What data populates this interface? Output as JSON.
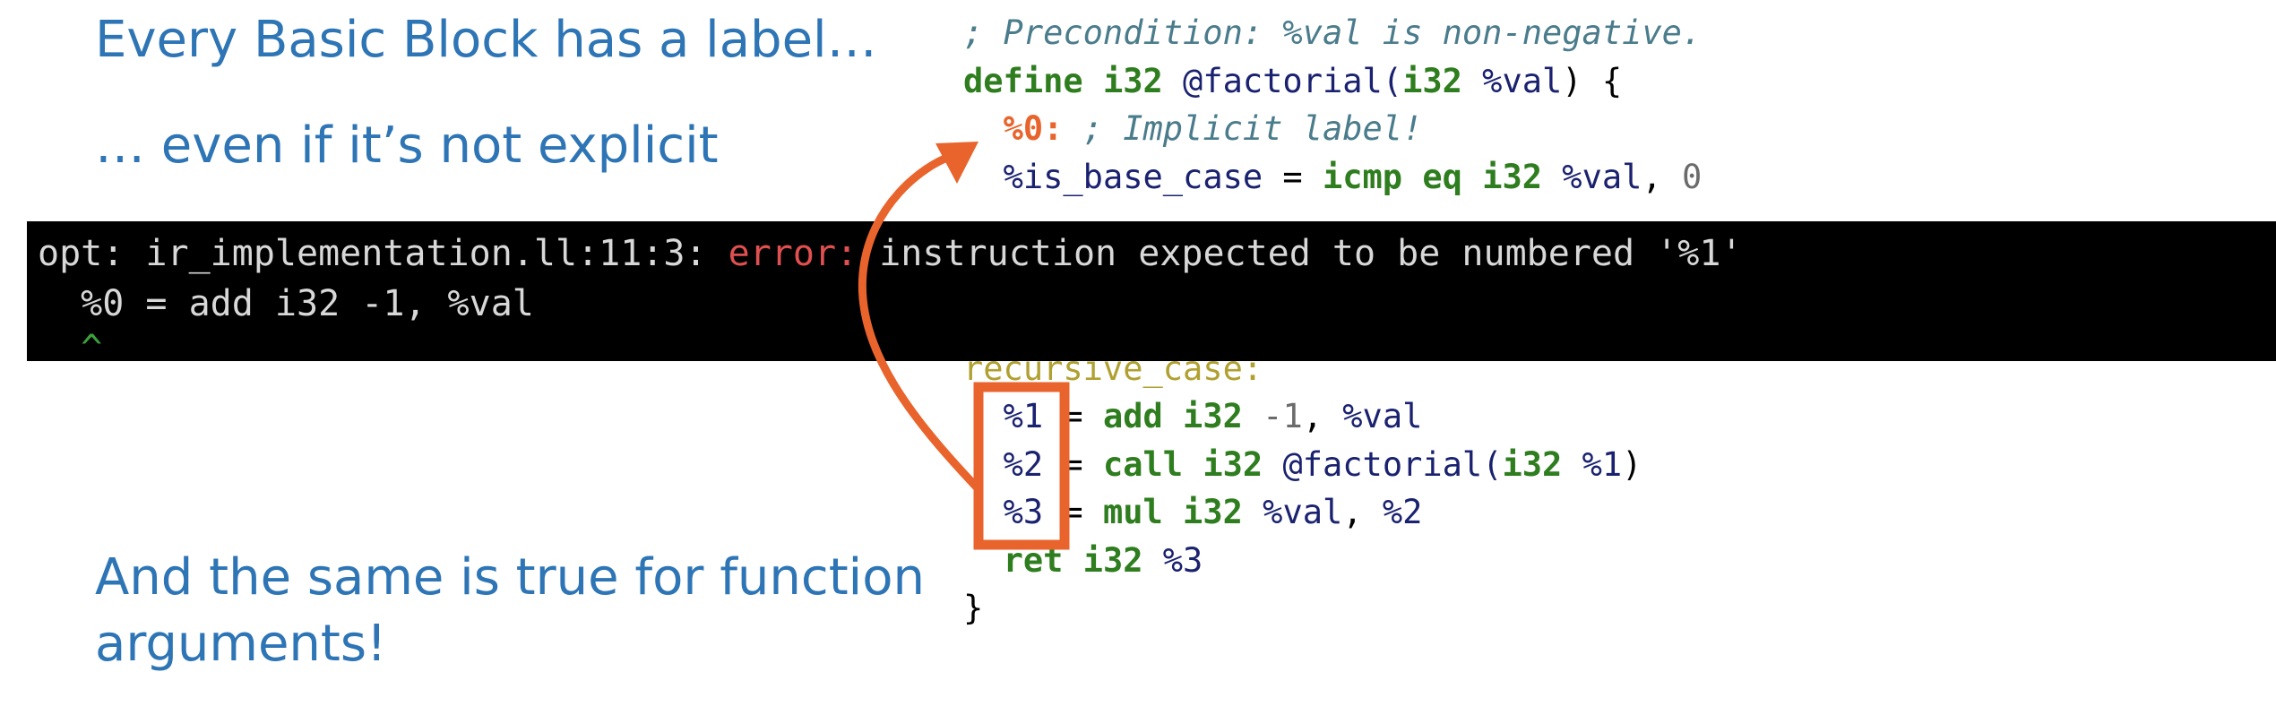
{
  "headings": {
    "line1": "Every Basic Block has a label…",
    "line2": "… even if it’s not explicit",
    "line3": "And the same is true for function arguments!"
  },
  "code": {
    "l1_comment": "; Precondition: %val is non-negative.",
    "l2_define": "define",
    "l2_type": "i32",
    "l2_fn": " @factorial(",
    "l2_argtype": "i32",
    "l2_arg": " %val",
    "l2_end": ") {",
    "l3_label": "%0:",
    "l3_comment": " ; Implicit label!",
    "l4_var": "%is_base_case",
    "l4_eq": " = ",
    "l4_op": "icmp eq",
    "l4_type": " i32",
    "l4_arg": " %val",
    "l4_rest": ", ",
    "l4_num": "0",
    "l5_block": "recursive_case:",
    "l6_var": "%1",
    "l6_eq": " = ",
    "l6_op": "add i32",
    "l6_num": " -1",
    "l6_rest": ", ",
    "l6_arg": "%val",
    "l7_var": "%2",
    "l7_eq": " = ",
    "l7_op": "call i32",
    "l7_fn": " @factorial(",
    "l7_argtype": "i32",
    "l7_arg": " %1",
    "l7_end": ")",
    "l8_var": "%3",
    "l8_eq": " = ",
    "l8_op": "mul i32",
    "l8_arg1": " %val",
    "l8_rest": ", ",
    "l8_arg2": "%2",
    "l9_op": "ret i32",
    "l9_arg": " %3",
    "l10_close": "}"
  },
  "terminal": {
    "prefix": "opt: ir_implementation.ll:11:3: ",
    "error_word": "error:",
    "message": " instruction expected to be numbered '%1'",
    "source_line": "  %0 = add i32 -1, %val",
    "caret": "  ^"
  },
  "colors": {
    "heading": "#2e75b6",
    "annotation": "#e8642c",
    "terminal_bg": "#000000",
    "error": "#e05050"
  }
}
